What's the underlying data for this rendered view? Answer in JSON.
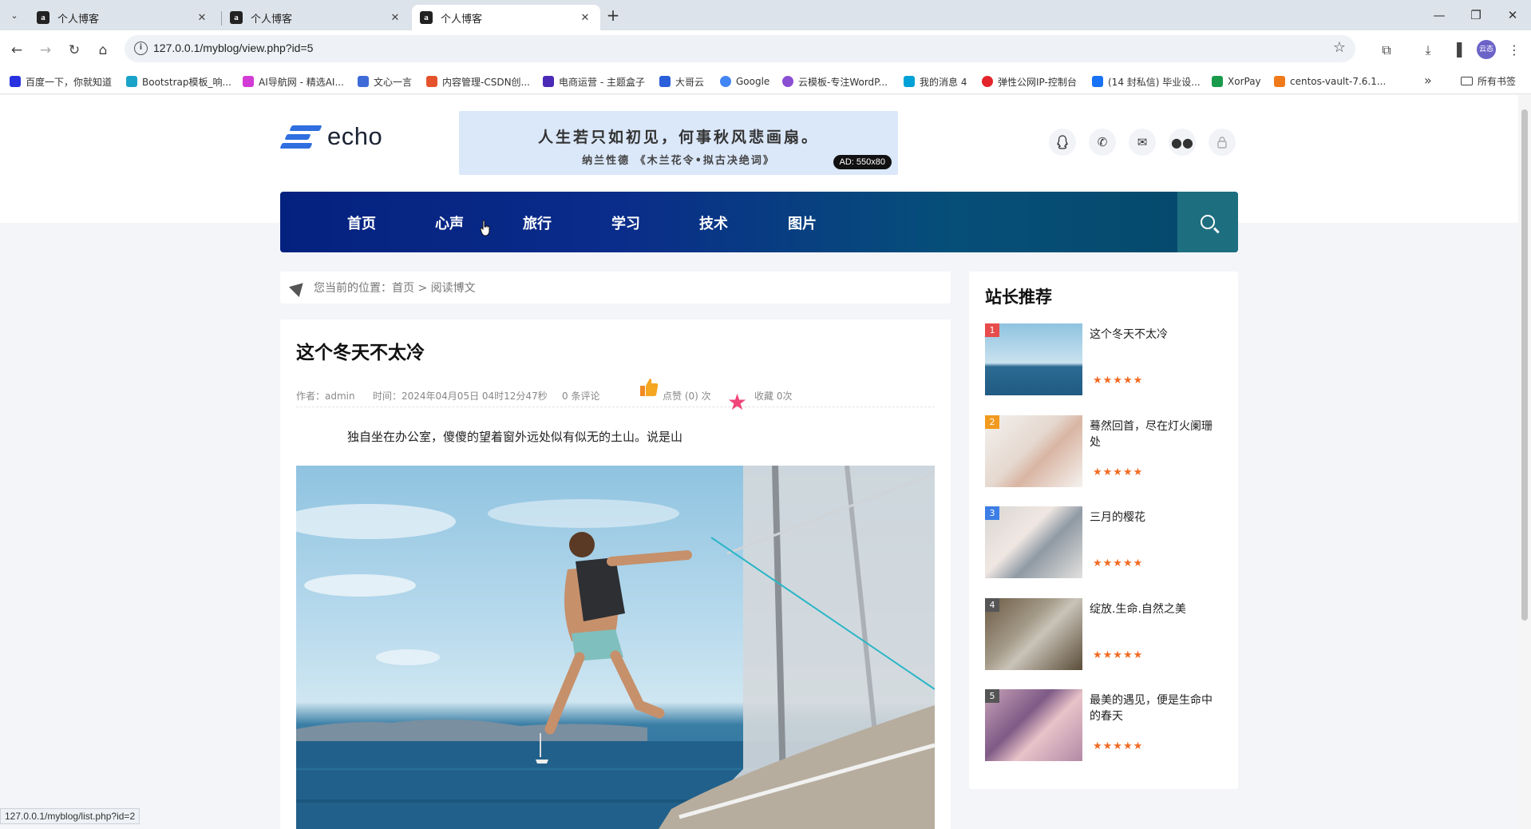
{
  "browser": {
    "tabs": [
      {
        "title": "个人博客",
        "favicon": "a"
      },
      {
        "title": "个人博客",
        "favicon": "a"
      },
      {
        "title": "个人博客",
        "favicon": "a"
      }
    ],
    "url": "127.0.0.1/myblog/view.php?id=5",
    "profile_initials": "云态",
    "bookmarks": [
      {
        "label": "百度一下，你就知道",
        "color": "#2932e1"
      },
      {
        "label": "Bootstrap模板_响...",
        "color": "#1aa3c8"
      },
      {
        "label": "AI导航网 - 精选AI...",
        "color": "#d23bd6"
      },
      {
        "label": "文心一言",
        "color": "#3f6bd8"
      },
      {
        "label": "内容管理-CSDN创...",
        "color": "#e5532d"
      },
      {
        "label": "电商运营 - 主题盒子",
        "color": "#4b2ab8"
      },
      {
        "label": "大哥云",
        "color": "#2b5fd9"
      },
      {
        "label": "Google",
        "color": "#4285f4"
      },
      {
        "label": "云模板-专注WordP...",
        "color": "#8a4fd2"
      },
      {
        "label": "我的消息 4",
        "color": "#00a1d6"
      },
      {
        "label": "弹性公网IP-控制台",
        "color": "#e3242b"
      },
      {
        "label": "(14 封私信) 毕业设...",
        "color": "#1772f6"
      },
      {
        "label": "XorPay",
        "color": "#1a9a4b"
      },
      {
        "label": "centos-vault-7.6.1...",
        "color": "#f07a1a"
      }
    ],
    "all_bookmarks": "所有书签",
    "status_url": "127.0.0.1/myblog/list.php?id=2"
  },
  "site": {
    "logo_text": "echo",
    "banner": {
      "line1": "人生若只如初见，何事秋风悲画扇。",
      "line2": "纳兰性德 《木兰花令•拟古决绝词》",
      "ad": "AD: 550x80"
    },
    "nav": [
      "首页",
      "心声",
      "旅行",
      "学习",
      "技术",
      "图片"
    ],
    "breadcrumb": "您当前的位置：首页 > 阅读博文"
  },
  "article": {
    "title": "这个冬天不太冷",
    "author": "作者：admin",
    "time": "时间：2024年04月05日 04时12分47秒",
    "comments": "0 条评论",
    "likes": "点赞 (0) 次",
    "favorites": "收藏 0次",
    "body": "独自坐在办公室，傻傻的望着窗外远处似有似无的土山。说是山"
  },
  "sidebar": {
    "title": "站长推荐",
    "items": [
      {
        "rank": "1",
        "title": "这个冬天不太冷",
        "rank_color": "#e84b4b"
      },
      {
        "rank": "2",
        "title": "蓦然回首，尽在灯火阑珊处",
        "rank_color": "#f29a1f"
      },
      {
        "rank": "3",
        "title": "三月的樱花",
        "rank_color": "#3d7ee6"
      },
      {
        "rank": "4",
        "title": "绽放.生命.自然之美",
        "rank_color": "#555555"
      },
      {
        "rank": "5",
        "title": "最美的遇见，便是生命中的春天",
        "rank_color": "#555555"
      }
    ],
    "stars": "★★★★★"
  }
}
